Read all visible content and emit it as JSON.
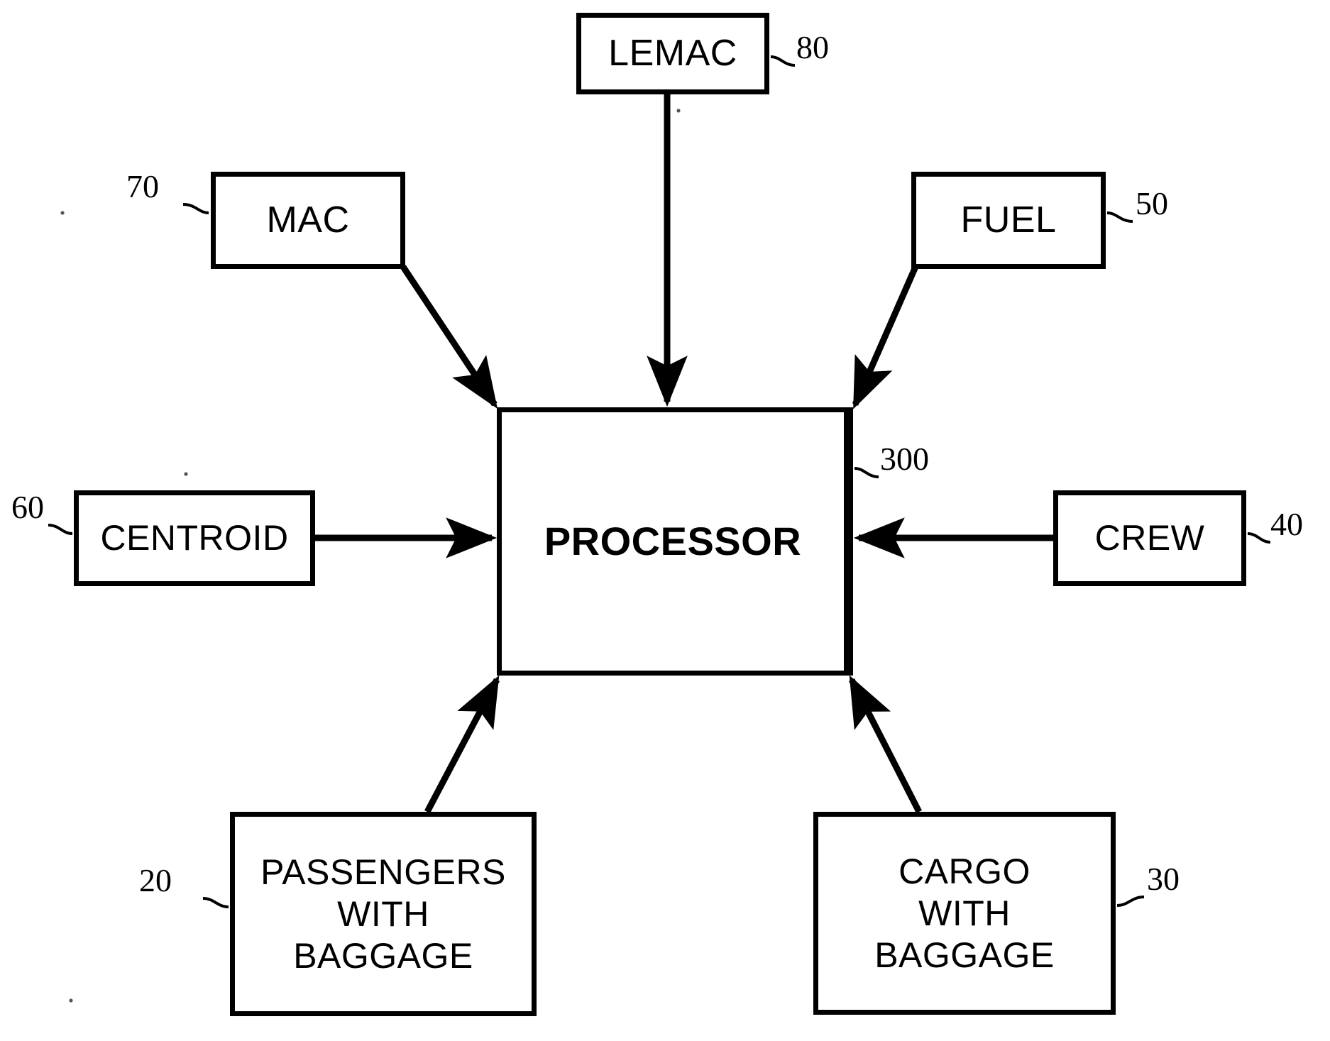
{
  "figure": {
    "type": "patent-block-diagram",
    "background_color": "#ffffff",
    "line_color": "#000000"
  },
  "nodes": [
    {
      "id": "lemac",
      "label": "LEMAC",
      "ref": "80"
    },
    {
      "id": "mac",
      "label": "MAC",
      "ref": "70"
    },
    {
      "id": "fuel",
      "label": "FUEL",
      "ref": "50"
    },
    {
      "id": "centroid",
      "label": "CENTROID",
      "ref": "60"
    },
    {
      "id": "crew",
      "label": "CREW",
      "ref": "40"
    },
    {
      "id": "processor",
      "label": "PROCESSOR",
      "ref": "300"
    },
    {
      "id": "passengers",
      "label": "PASSENGERS\nWITH\nBAGGAGE",
      "ref": "20"
    },
    {
      "id": "cargo",
      "label": "CARGO\nWITH\nBAGGAGE",
      "ref": "30"
    }
  ],
  "edges": [
    {
      "from": "lemac",
      "to": "processor",
      "direction": "down"
    },
    {
      "from": "mac",
      "to": "processor",
      "direction": "down-right"
    },
    {
      "from": "fuel",
      "to": "processor",
      "direction": "down-left"
    },
    {
      "from": "centroid",
      "to": "processor",
      "direction": "right"
    },
    {
      "from": "crew",
      "to": "processor",
      "direction": "left"
    },
    {
      "from": "passengers",
      "to": "processor",
      "direction": "up-right"
    },
    {
      "from": "cargo",
      "to": "processor",
      "direction": "up-left"
    }
  ],
  "labels": {
    "lemac": "LEMAC",
    "mac": "MAC",
    "fuel": "FUEL",
    "centroid": "CENTROID",
    "crew": "CREW",
    "processor": "PROCESSOR",
    "passengers": "PASSENGERS\nWITH\nBAGGAGE",
    "cargo": "CARGO\nWITH\nBAGGAGE"
  },
  "ref_numbers": {
    "lemac": "80",
    "mac": "70",
    "fuel": "50",
    "centroid": "60",
    "crew": "40",
    "processor": "300",
    "passengers": "20",
    "cargo": "30"
  }
}
